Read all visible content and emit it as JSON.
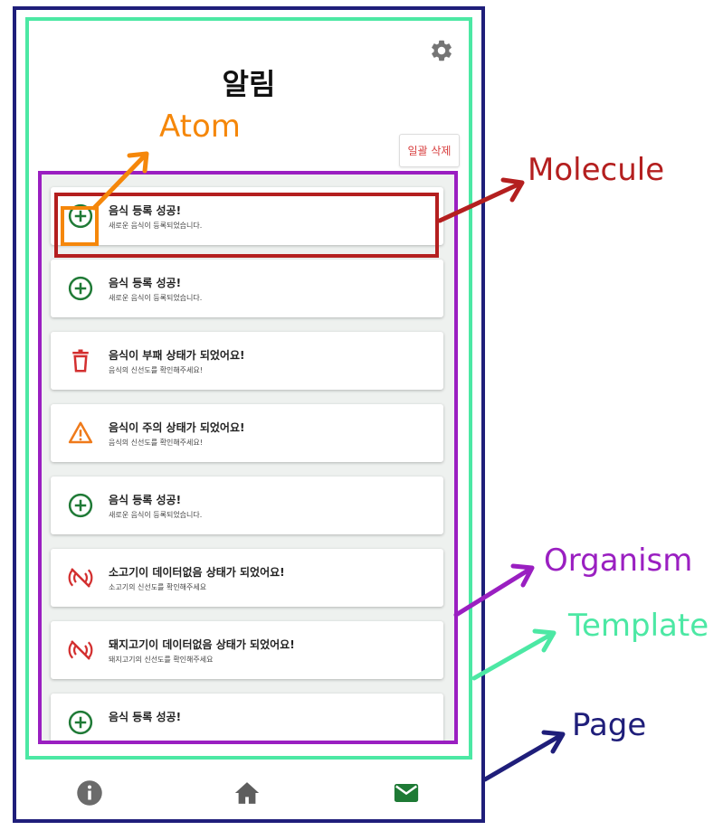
{
  "screen": {
    "title": "알림",
    "clear_all_label": "일괄 삭제",
    "notifications": [
      {
        "icon": "plus-circle-icon",
        "color": "#1f7a36",
        "title": "음식 등록 성공!",
        "message": "새로운 음식이 등록되었습니다."
      },
      {
        "icon": "plus-circle-icon",
        "color": "#1f7a36",
        "title": "음식 등록 성공!",
        "message": "새로운 음식이 등록되었습니다."
      },
      {
        "icon": "trash-icon",
        "color": "#d32f2f",
        "title": "음식이 부패 상태가 되었어요!",
        "message": "음식의 신선도를 확인해주세요!"
      },
      {
        "icon": "warning-icon",
        "color": "#ef7a1a",
        "title": "음식이 주의 상태가 되었어요!",
        "message": "음식의 신선도를 확인해주세요!"
      },
      {
        "icon": "plus-circle-icon",
        "color": "#1f7a36",
        "title": "음식 등록 성공!",
        "message": "새로운 음식이 등록되었습니다."
      },
      {
        "icon": "no-signal-icon",
        "color": "#d32f2f",
        "title": "소고기이 데이터없음 상태가 되었어요!",
        "message": "소고기의 신선도를 확인해주세요"
      },
      {
        "icon": "no-signal-icon",
        "color": "#d32f2f",
        "title": "돼지고기이 데이터없음 상태가 되었어요!",
        "message": "돼지고기의 신선도를 확인해주세요"
      },
      {
        "icon": "plus-circle-icon",
        "color": "#1f7a36",
        "title": "음식 등록 성공!",
        "message": ""
      }
    ],
    "nav": [
      "info-icon",
      "home-icon",
      "mail-icon"
    ]
  },
  "annotations": {
    "atom": {
      "label": "Atom",
      "color": "#f5870a"
    },
    "molecule": {
      "label": "Molecule",
      "color": "#b41f1f"
    },
    "organism": {
      "label": "Organism",
      "color": "#9a1fc1"
    },
    "template": {
      "label": "Template",
      "color": "#4ce8a4"
    },
    "page": {
      "label": "Page",
      "color": "#1f1e7a"
    }
  }
}
